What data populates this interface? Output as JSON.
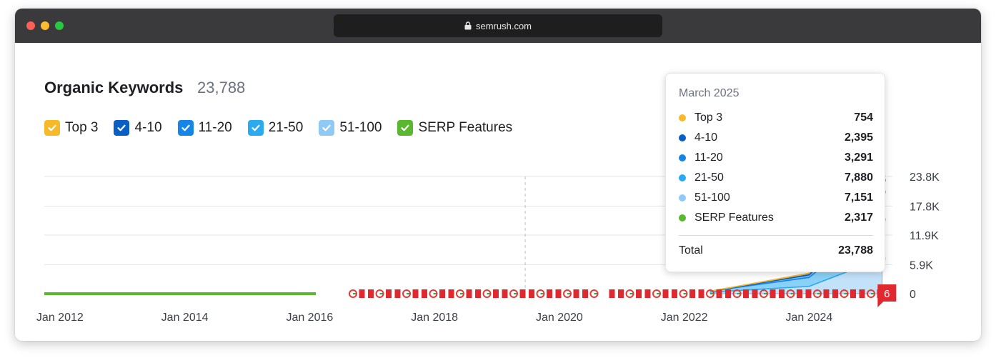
{
  "browser": {
    "url": "semrush.com"
  },
  "header": {
    "title": "Organic Keywords",
    "count": "23,788"
  },
  "legend": [
    {
      "label": "Top 3",
      "color": "#f7b928"
    },
    {
      "label": "4-10",
      "color": "#0a5ec4"
    },
    {
      "label": "11-20",
      "color": "#1586e8"
    },
    {
      "label": "21-50",
      "color": "#2aabf0"
    },
    {
      "label": "51-100",
      "color": "#8fcaf6"
    },
    {
      "label": "SERP Features",
      "color": "#5ab82e"
    }
  ],
  "tooltip": {
    "date": "March 2025",
    "rows": [
      {
        "label": "Top 3",
        "value": "754",
        "color": "#f7b928"
      },
      {
        "label": "4-10",
        "value": "2,395",
        "color": "#0a5ec4"
      },
      {
        "label": "11-20",
        "value": "3,291",
        "color": "#1586e8"
      },
      {
        "label": "21-50",
        "value": "7,880",
        "color": "#2aabf0"
      },
      {
        "label": "51-100",
        "value": "7,151",
        "color": "#8fcaf6"
      },
      {
        "label": "SERP Features",
        "value": "2,317",
        "color": "#5ab82e"
      }
    ],
    "total_label": "Total",
    "total_value": "23,788"
  },
  "chart_data": {
    "type": "area",
    "title": "Organic Keywords",
    "x_ticks": [
      "Jan 2012",
      "Jan 2014",
      "Jan 2016",
      "Jan 2018",
      "Jan 2020",
      "Jan 2022",
      "Jan 2024"
    ],
    "y_ticks": [
      "0",
      "5.9K",
      "11.9K",
      "17.8K",
      "23.8K"
    ],
    "ylim": [
      0,
      23800
    ],
    "grid": true,
    "notes_badge": "6",
    "series": [
      {
        "name": "Top 3",
        "points": [
          [
            "2012-01",
            0
          ],
          [
            "2022-06",
            0
          ],
          [
            "2024-01",
            80
          ],
          [
            "2025-03",
            754
          ]
        ]
      },
      {
        "name": "4-10",
        "points": [
          [
            "2012-01",
            0
          ],
          [
            "2022-06",
            0
          ],
          [
            "2024-01",
            300
          ],
          [
            "2025-03",
            2395
          ]
        ]
      },
      {
        "name": "11-20",
        "points": [
          [
            "2012-01",
            0
          ],
          [
            "2022-06",
            0
          ],
          [
            "2024-01",
            500
          ],
          [
            "2025-03",
            3291
          ]
        ]
      },
      {
        "name": "21-50",
        "points": [
          [
            "2012-01",
            0
          ],
          [
            "2022-06",
            200
          ],
          [
            "2024-01",
            1800
          ],
          [
            "2025-03",
            7880
          ]
        ]
      },
      {
        "name": "51-100",
        "points": [
          [
            "2012-01",
            0
          ],
          [
            "2022-06",
            300
          ],
          [
            "2024-01",
            1500
          ],
          [
            "2025-03",
            7151
          ]
        ]
      },
      {
        "name": "SERP Features",
        "points": [
          [
            "2012-01",
            0
          ],
          [
            "2025-03",
            2317
          ]
        ]
      }
    ],
    "hover_date": "2025-03"
  }
}
